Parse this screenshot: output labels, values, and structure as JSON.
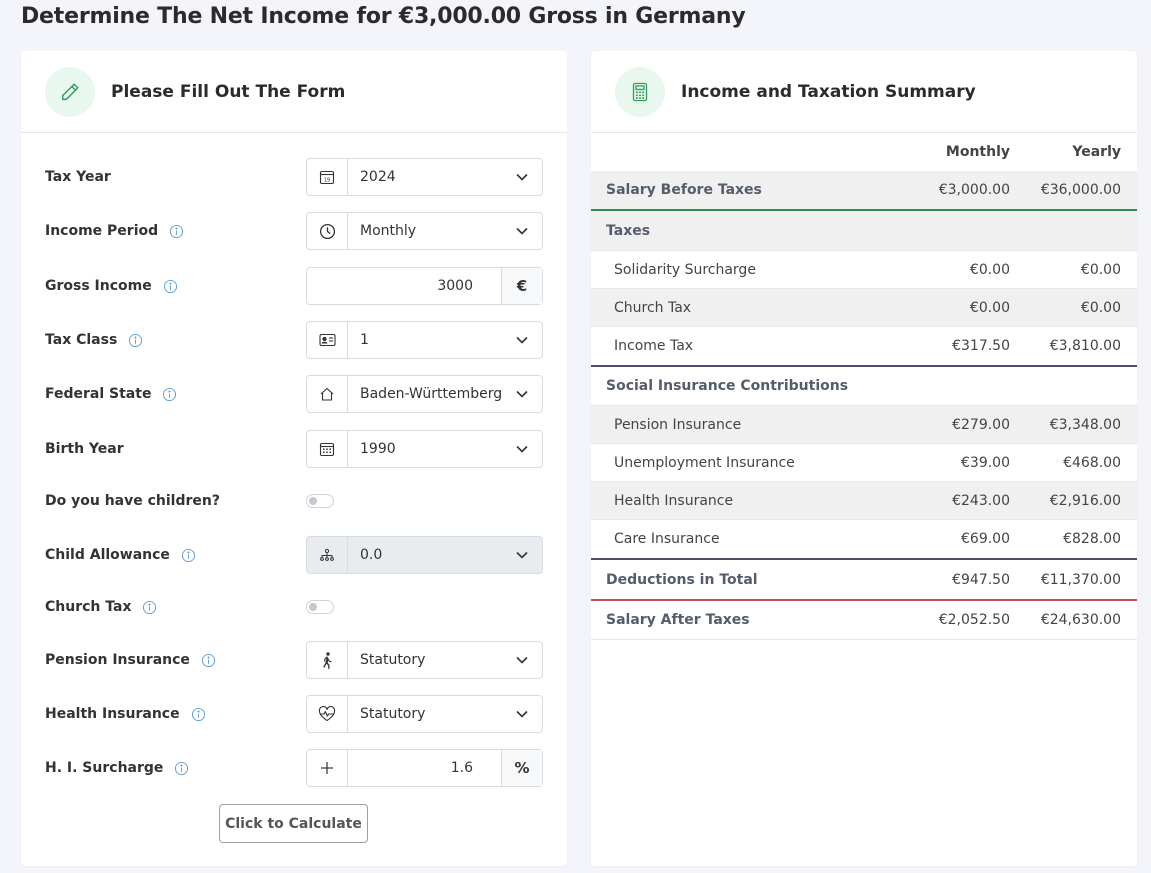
{
  "page": {
    "title": "Determine The Net Income for €3,000.00 Gross in Germany"
  },
  "form": {
    "title": "Please Fill Out The Form",
    "tax_year": {
      "label": "Tax Year",
      "value": "2024"
    },
    "income_period": {
      "label": "Income Period",
      "value": "Monthly"
    },
    "gross_income": {
      "label": "Gross Income",
      "value": "3000",
      "unit": "€"
    },
    "tax_class": {
      "label": "Tax Class",
      "value": "1"
    },
    "federal_state": {
      "label": "Federal State",
      "value": "Baden-Württemberg"
    },
    "birth_year": {
      "label": "Birth Year",
      "value": "1990"
    },
    "children": {
      "label": "Do you have children?"
    },
    "child_allowance": {
      "label": "Child Allowance",
      "value": "0.0"
    },
    "church_tax": {
      "label": "Church Tax"
    },
    "pension_insurance": {
      "label": "Pension Insurance",
      "value": "Statutory"
    },
    "health_insurance": {
      "label": "Health Insurance",
      "value": "Statutory"
    },
    "hi_surcharge": {
      "label": "H. I. Surcharge",
      "value": "1.6",
      "unit": "%"
    },
    "calculate_label": "Click to Calculate"
  },
  "summary": {
    "title": "Income and Taxation Summary",
    "col_monthly": "Monthly",
    "col_yearly": "Yearly",
    "rows": [
      {
        "label": "Salary Before Taxes",
        "monthly": "€3,000.00",
        "yearly": "€36,000.00"
      },
      {
        "label": "Taxes",
        "monthly": "",
        "yearly": ""
      },
      {
        "label": "Solidarity Surcharge",
        "monthly": "€0.00",
        "yearly": "€0.00"
      },
      {
        "label": "Church Tax",
        "monthly": "€0.00",
        "yearly": "€0.00"
      },
      {
        "label": "Income Tax",
        "monthly": "€317.50",
        "yearly": "€3,810.00"
      },
      {
        "label": "Social Insurance Contributions",
        "monthly": "",
        "yearly": ""
      },
      {
        "label": "Pension Insurance",
        "monthly": "€279.00",
        "yearly": "€3,348.00"
      },
      {
        "label": "Unemployment Insurance",
        "monthly": "€39.00",
        "yearly": "€468.00"
      },
      {
        "label": "Health Insurance",
        "monthly": "€243.00",
        "yearly": "€2,916.00"
      },
      {
        "label": "Care Insurance",
        "monthly": "€69.00",
        "yearly": "€828.00"
      },
      {
        "label": "Deductions in Total",
        "monthly": "€947.50",
        "yearly": "€11,370.00"
      },
      {
        "label": "Salary After Taxes",
        "monthly": "€2,052.50",
        "yearly": "€24,630.00"
      }
    ]
  },
  "colors": {
    "accent_green": "#2e8b57",
    "total_red": "#c0504d",
    "divider_dark": "#4a5060",
    "icon_blue": "#5b9bd5"
  }
}
